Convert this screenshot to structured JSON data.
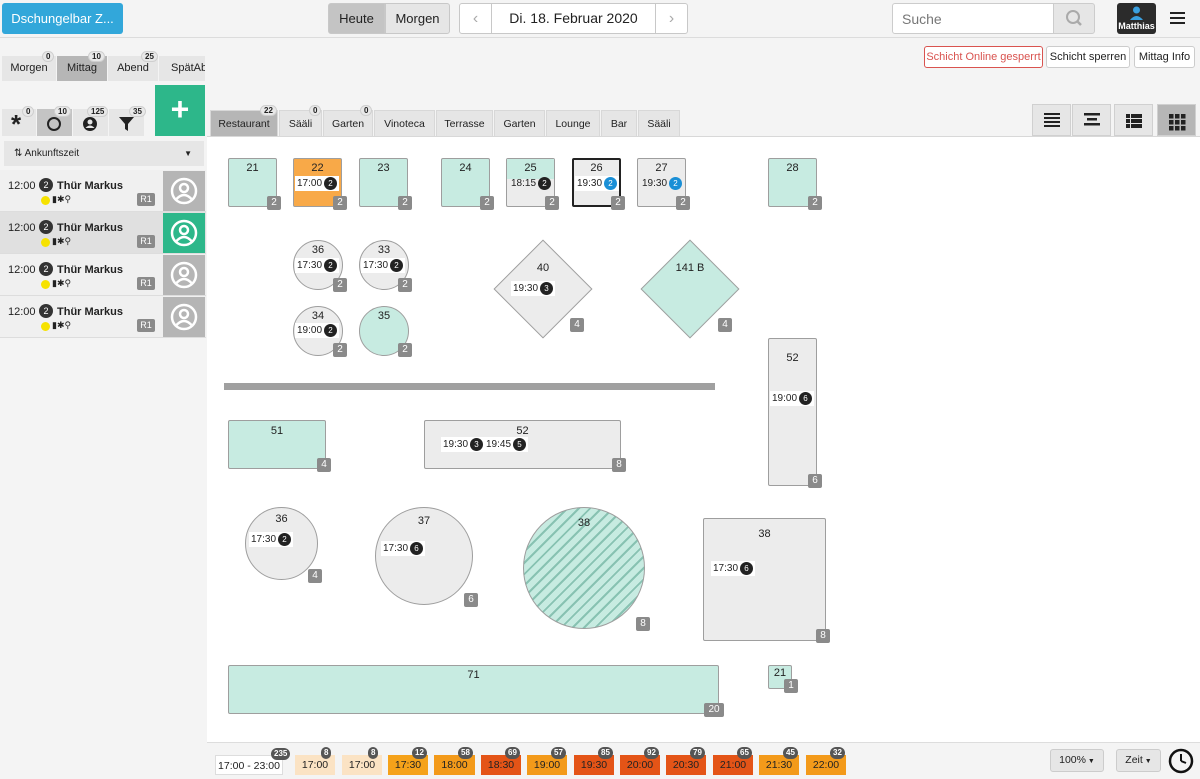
{
  "topbar": {
    "brand": "Dschungelbar Z...",
    "today": "Heute",
    "tomorrow": "Morgen",
    "date": "Di. 18. Februar 2020",
    "search_placeholder": "Suche",
    "user": "Matthias"
  },
  "shifts": [
    {
      "label": "Morgen",
      "count": "0"
    },
    {
      "label": "Mittag",
      "count": "10"
    },
    {
      "label": "Abend",
      "count": "25"
    },
    {
      "label": "SpätAbe",
      "count": ""
    }
  ],
  "actions": {
    "online": "Schicht Online gesperrt",
    "lock": "Schicht sperren",
    "info": "Mittag Info"
  },
  "filters": [
    {
      "icon": "asterisk-icon",
      "count": "0"
    },
    {
      "icon": "circle-icon",
      "count": "10"
    },
    {
      "icon": "user-circle-icon",
      "count": "125"
    },
    {
      "icon": "filter-icon",
      "count": "35"
    }
  ],
  "add_label": "+",
  "sort_label": "Ankunftszeit",
  "reservations": [
    {
      "time": "12:00",
      "persons": "2",
      "name": "Thür Markus",
      "room": "R1"
    },
    {
      "time": "12:00",
      "persons": "2",
      "name": "Thür Markus",
      "room": "R1"
    },
    {
      "time": "12:00",
      "persons": "2",
      "name": "Thür Markus",
      "room": "R1"
    },
    {
      "time": "12:00",
      "persons": "2",
      "name": "Thür Markus",
      "room": "R1"
    }
  ],
  "rooms": [
    {
      "label": "Restaurant",
      "count": "22"
    },
    {
      "label": "Sääli",
      "count": "0"
    },
    {
      "label": "Garten",
      "count": "0"
    },
    {
      "label": "Vinoteca",
      "count": ""
    },
    {
      "label": "Terrasse",
      "count": ""
    },
    {
      "label": "Garten",
      "count": ""
    },
    {
      "label": "Lounge",
      "count": ""
    },
    {
      "label": "Bar",
      "count": ""
    },
    {
      "label": "Sääli",
      "count": ""
    }
  ],
  "tables": [
    {
      "num": "21",
      "seats": "2",
      "slots": []
    },
    {
      "num": "22",
      "seats": "2",
      "slots": [
        {
          "time": "17:00",
          "p": "2"
        }
      ]
    },
    {
      "num": "23",
      "seats": "2",
      "slots": []
    },
    {
      "num": "24",
      "seats": "2",
      "slots": []
    },
    {
      "num": "25",
      "seats": "2",
      "slots": [
        {
          "time": "18:15",
          "p": "2"
        }
      ]
    },
    {
      "num": "26",
      "seats": "2",
      "slots": [
        {
          "time": "19:30",
          "p": "2"
        }
      ]
    },
    {
      "num": "27",
      "seats": "2",
      "slots": [
        {
          "time": "19:30",
          "p": "2"
        }
      ]
    },
    {
      "num": "28",
      "seats": "2",
      "slots": []
    },
    {
      "num": "36",
      "seats": "2",
      "slots": [
        {
          "time": "17:30",
          "p": "2"
        }
      ]
    },
    {
      "num": "33",
      "seats": "2",
      "slots": [
        {
          "time": "17:30",
          "p": "2"
        }
      ]
    },
    {
      "num": "40",
      "seats": "4",
      "slots": [
        {
          "time": "19:30",
          "p": "3"
        }
      ]
    },
    {
      "num": "141 B",
      "seats": "4",
      "slots": []
    },
    {
      "num": "34",
      "seats": "2",
      "slots": [
        {
          "time": "19:00",
          "p": "2"
        }
      ]
    },
    {
      "num": "35",
      "seats": "2",
      "slots": []
    },
    {
      "num": "52",
      "seats": "6",
      "slots": [
        {
          "time": "19:00",
          "p": "6"
        }
      ]
    },
    {
      "num": "51",
      "seats": "4",
      "slots": []
    },
    {
      "num": "52",
      "seats": "8",
      "slots": [
        {
          "time": "19:30",
          "p": "3"
        },
        {
          "time": "19:45",
          "p": "5"
        }
      ]
    },
    {
      "num": "36",
      "seats": "4",
      "slots": [
        {
          "time": "17:30",
          "p": "2"
        }
      ]
    },
    {
      "num": "37",
      "seats": "6",
      "slots": [
        {
          "time": "17:30",
          "p": "6"
        }
      ]
    },
    {
      "num": "38",
      "seats": "8",
      "slots": []
    },
    {
      "num": "38",
      "seats": "8",
      "slots": [
        {
          "time": "17:30",
          "p": "6"
        }
      ]
    },
    {
      "num": "71",
      "seats": "20",
      "slots": []
    },
    {
      "num": "21",
      "seats": "1",
      "slots": []
    }
  ],
  "timeline": [
    {
      "label": "17:00 - 23:00",
      "count": "235",
      "color": "#ffffff"
    },
    {
      "label": "17:00",
      "count": "8",
      "color": "#fbe3c4"
    },
    {
      "label": "17:00",
      "count": "8",
      "color": "#fbe3c4"
    },
    {
      "label": "17:30",
      "count": "12",
      "color": "#f5a21a"
    },
    {
      "label": "18:00",
      "count": "58",
      "color": "#f39a1a"
    },
    {
      "label": "18:30",
      "count": "69",
      "color": "#e45417"
    },
    {
      "label": "19:00",
      "count": "57",
      "color": "#f39a1a"
    },
    {
      "label": "19:30",
      "count": "85",
      "color": "#e45417"
    },
    {
      "label": "20:00",
      "count": "92",
      "color": "#e45417"
    },
    {
      "label": "20:30",
      "count": "79",
      "color": "#e45417"
    },
    {
      "label": "21:00",
      "count": "65",
      "color": "#e45417"
    },
    {
      "label": "21:30",
      "count": "45",
      "color": "#f39a1a"
    },
    {
      "label": "22:00",
      "count": "32",
      "color": "#f39a1a"
    }
  ],
  "zoom": "100%",
  "zeit": "Zeit"
}
